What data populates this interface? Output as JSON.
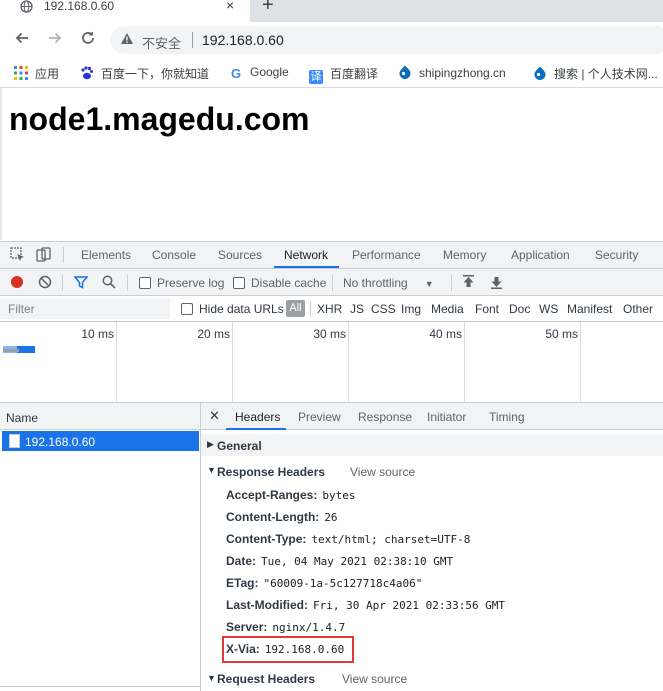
{
  "browser": {
    "tab_title": "192.168.0.60",
    "close_glyph": "×",
    "new_tab_glyph": "+",
    "insecure_label": "不安全",
    "url": "192.168.0.60"
  },
  "bookmarks": [
    {
      "label": "应用",
      "icon": "apps-grid-icon"
    },
    {
      "label": "百度一下，你就知道",
      "icon": "baidu-paw-icon"
    },
    {
      "label": "Google",
      "icon": "google-g-icon"
    },
    {
      "label": "百度翻译",
      "icon": "translate-icon"
    },
    {
      "label": "shipingzhong.cn",
      "icon": "drupal-drop-icon"
    },
    {
      "label": "搜索 | 个人技术网...",
      "icon": "drupal-drop-icon"
    }
  ],
  "page": {
    "heading": "node1.magedu.com"
  },
  "devtools": {
    "tabs": [
      "Elements",
      "Console",
      "Sources",
      "Network",
      "Performance",
      "Memory",
      "Application",
      "Security"
    ],
    "active_tab": "Network",
    "toolbar": {
      "preserve_log": "Preserve log",
      "disable_cache": "Disable cache",
      "throttling": "No throttling"
    },
    "filter": {
      "placeholder": "Filter",
      "hide_data_urls": "Hide data URLs",
      "all": "All",
      "types": [
        "XHR",
        "JS",
        "CSS",
        "Img",
        "Media",
        "Font",
        "Doc",
        "WS",
        "Manifest",
        "Other"
      ]
    },
    "timeline_ticks": [
      "10 ms",
      "20 ms",
      "30 ms",
      "40 ms",
      "50 ms"
    ],
    "name_column_header": "Name",
    "request_name": "192.168.0.60",
    "detail_tabs": [
      "Headers",
      "Preview",
      "Response",
      "Initiator",
      "Timing"
    ],
    "sections": {
      "general": "General",
      "response_headers": "Response Headers",
      "request_headers": "Request Headers",
      "view_source": "View source"
    },
    "response_headers": [
      {
        "name": "Accept-Ranges:",
        "value": "bytes"
      },
      {
        "name": "Content-Length:",
        "value": "26"
      },
      {
        "name": "Content-Type:",
        "value": "text/html; charset=UTF-8"
      },
      {
        "name": "Date:",
        "value": "Tue, 04 May 2021 02:38:10 GMT"
      },
      {
        "name": "ETag:",
        "value": "\"60009-1a-5c127718c4a06\""
      },
      {
        "name": "Last-Modified:",
        "value": "Fri, 30 Apr 2021 02:33:56 GMT"
      },
      {
        "name": "Server:",
        "value": "nginx/1.4.7"
      },
      {
        "name": "X-Via:",
        "value": "192.168.0.60"
      }
    ]
  },
  "colors": {
    "accent": "#1a73e8",
    "highlight_box": "#e23a3a",
    "record_red": "#d93025"
  }
}
